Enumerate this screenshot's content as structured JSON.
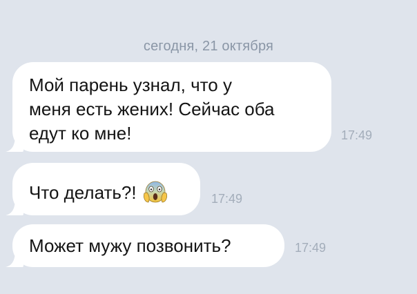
{
  "date_separator": "сегодня, 21 октября",
  "messages": [
    {
      "text": "Мой парень узнал, что у\nменя есть жених! Сейчас оба\nедут ко мне!",
      "time": "17:49"
    },
    {
      "text": "Что делать?!",
      "emoji": "screaming-face-emoji",
      "time": "17:49"
    },
    {
      "text": "Может мужу позвонить?",
      "time": "17:49"
    }
  ],
  "colors": {
    "background": "#dfe4ec",
    "bubble": "#ffffff",
    "time": "#a3adba",
    "date": "#8a96a6"
  }
}
